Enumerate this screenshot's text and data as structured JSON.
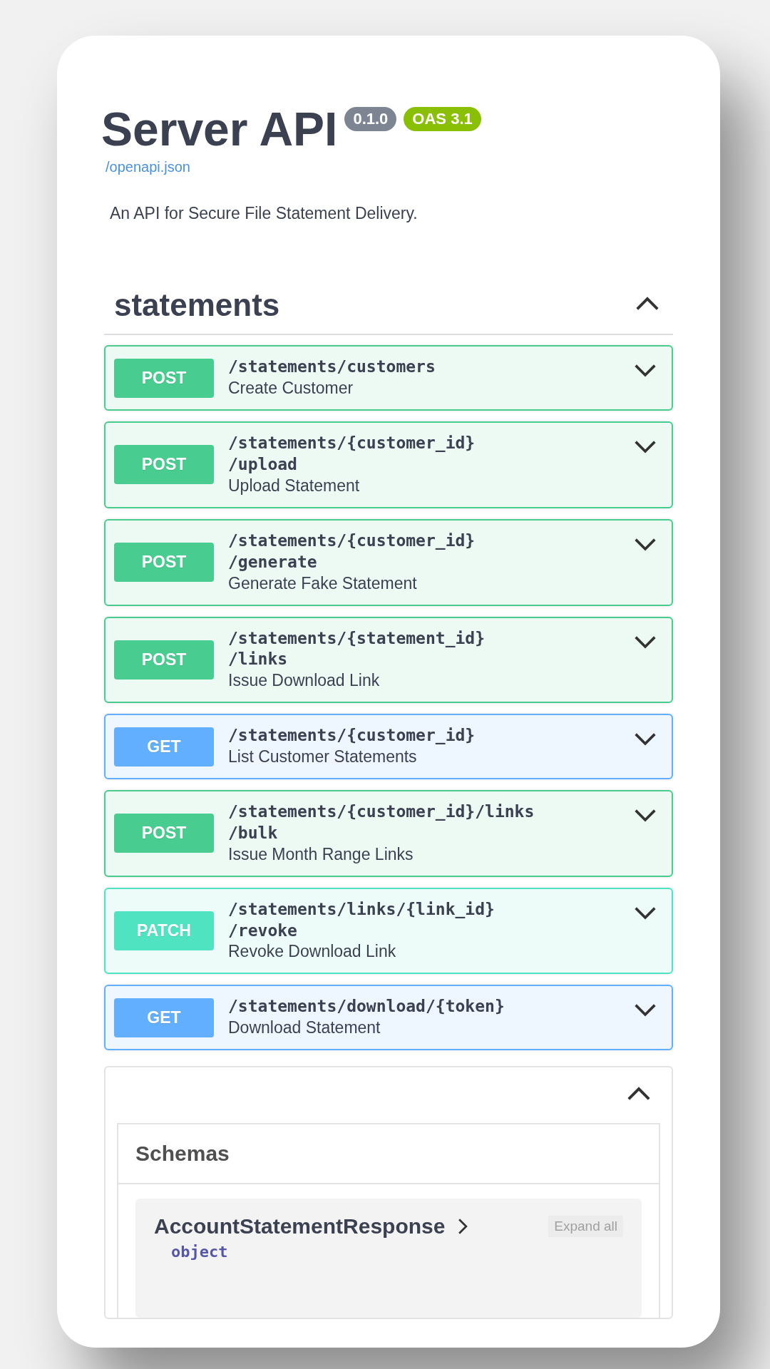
{
  "info": {
    "title": "Server API",
    "version": "0.1.0",
    "oas_badge": "OAS 3.1",
    "spec_link": "/openapi.json",
    "description": "An API for Secure File Statement Delivery."
  },
  "tag": {
    "name": "statements",
    "expanded": true
  },
  "operations": [
    {
      "kind": "post",
      "method": "POST",
      "path": "/statements/customers",
      "summary": "Create Customer",
      "expanded": false
    },
    {
      "kind": "post",
      "method": "POST",
      "path": "/statements/{customer_id}/upload",
      "summary": "Upload Statement",
      "expanded": false
    },
    {
      "kind": "post",
      "method": "POST",
      "path": "/statements/{customer_id}/generate",
      "summary": "Generate Fake Statement",
      "expanded": false
    },
    {
      "kind": "post",
      "method": "POST",
      "path": "/statements/{statement_id}/links",
      "summary": "Issue Download Link",
      "expanded": false
    },
    {
      "kind": "get",
      "method": "GET",
      "path": "/statements/{customer_id}",
      "summary": "List Customer Statements",
      "expanded": false
    },
    {
      "kind": "post",
      "method": "POST",
      "path": "/statements/{customer_id}/links/bulk",
      "summary": "Issue Month Range Links",
      "expanded": false
    },
    {
      "kind": "patch",
      "method": "PATCH",
      "path": "/statements/links/{link_id}/revoke",
      "summary": "Revoke Download Link",
      "expanded": false
    },
    {
      "kind": "get",
      "method": "GET",
      "path": "/statements/download/{token}",
      "summary": "Download Statement",
      "expanded": false
    }
  ],
  "schemas": {
    "title": "Schemas",
    "expanded": true,
    "models": [
      {
        "name": "AccountStatementResponse",
        "expanded": false,
        "expand_all": "Expand all",
        "type": "object"
      }
    ]
  }
}
